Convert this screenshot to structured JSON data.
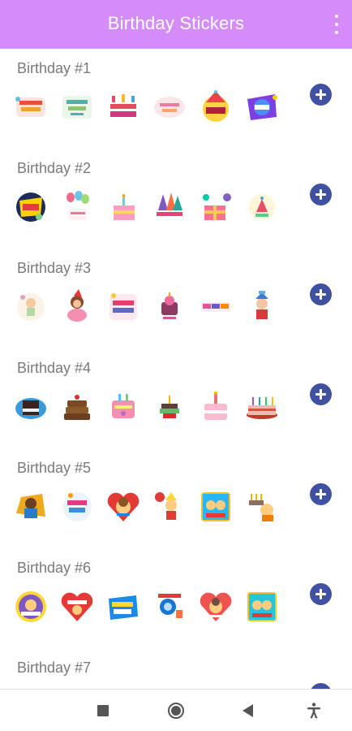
{
  "appbar": {
    "title": "Birthday Stickers",
    "background": "#d58cf8",
    "menu_icon": "overflow-menu-icon"
  },
  "packs": [
    {
      "name": "Birthday #1",
      "stickers": [
        "birthday-sticker-1-1",
        "birthday-sticker-1-2",
        "birthday-sticker-1-3",
        "birthday-sticker-1-4",
        "birthday-sticker-1-5",
        "birthday-sticker-1-6"
      ]
    },
    {
      "name": "Birthday #2",
      "stickers": [
        "birthday-sticker-2-1",
        "birthday-sticker-2-2",
        "birthday-sticker-2-3",
        "birthday-sticker-2-4",
        "birthday-sticker-2-5",
        "birthday-sticker-2-6"
      ]
    },
    {
      "name": "Birthday #3",
      "stickers": [
        "birthday-sticker-3-1",
        "birthday-sticker-3-2",
        "birthday-sticker-3-3",
        "birthday-sticker-3-4",
        "birthday-sticker-3-5",
        "birthday-sticker-3-6"
      ]
    },
    {
      "name": "Birthday #4",
      "stickers": [
        "birthday-sticker-4-1",
        "birthday-sticker-4-2",
        "birthday-sticker-4-3",
        "birthday-sticker-4-4",
        "birthday-sticker-4-5",
        "birthday-sticker-4-6"
      ]
    },
    {
      "name": "Birthday #5",
      "stickers": [
        "birthday-sticker-5-1",
        "birthday-sticker-5-2",
        "birthday-sticker-5-3",
        "birthday-sticker-5-4",
        "birthday-sticker-5-5",
        "birthday-sticker-5-6"
      ]
    },
    {
      "name": "Birthday #6",
      "stickers": [
        "birthday-sticker-6-1",
        "birthday-sticker-6-2",
        "birthday-sticker-6-3",
        "birthday-sticker-6-4",
        "birthday-sticker-6-5",
        "birthday-sticker-6-6"
      ]
    },
    {
      "name": "Birthday #7",
      "stickers": []
    }
  ],
  "add_button": {
    "icon": "add-circle-icon",
    "color": "#3f51a0"
  },
  "navbar": {
    "items": [
      "recents-square-icon",
      "home-circle-icon",
      "back-triangle-icon",
      "accessibility-icon"
    ]
  }
}
